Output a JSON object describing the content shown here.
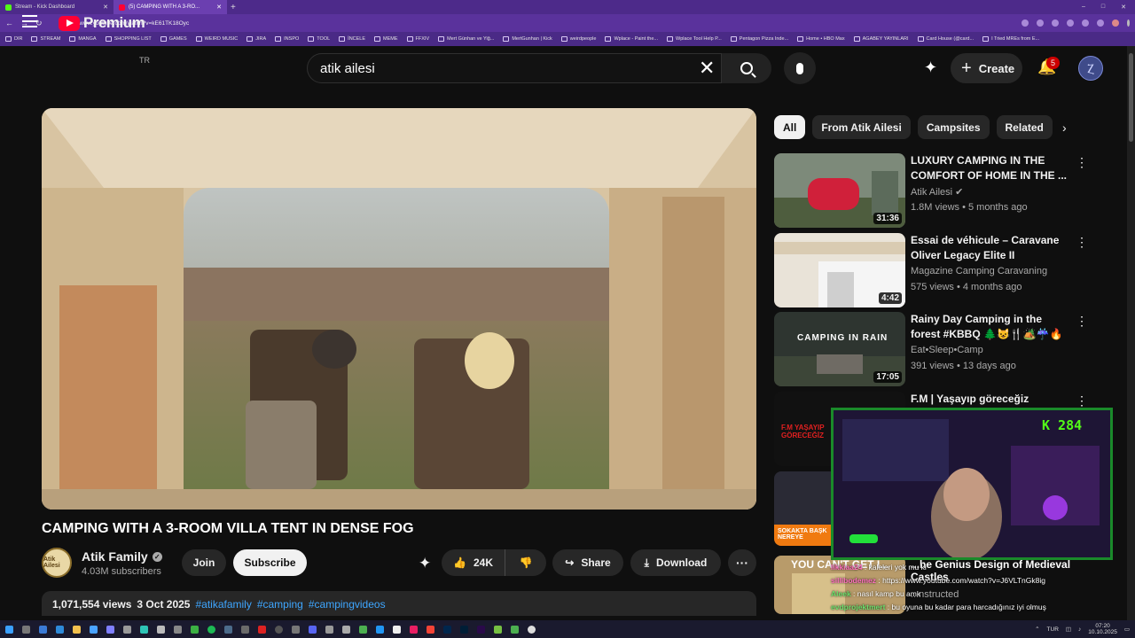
{
  "browser": {
    "tabs": [
      {
        "title": "Stream - Kick Dashboard",
        "favicon_color": "#53fc18",
        "active": false
      },
      {
        "title": "(5) CAMPING WITH A 3-RO...",
        "favicon_color": "#ff0033",
        "active": true
      }
    ],
    "new_tab": "+",
    "window_controls": [
      "–",
      "□",
      "✕"
    ],
    "url": "https://www.youtube.com/watch?v=kE61TK18Oyc",
    "bookmarks": [
      "DIR",
      "STREAM",
      "MANGA",
      "SHOPPING LIST",
      "GAMES",
      "WEIRD MUSIC",
      "JIRA",
      "INSPO",
      "TOOL",
      "İNCELE",
      "MEME",
      "FFXIV",
      "Mert Günhan ve Yiğ...",
      "MertGunhan | Kick",
      "weirdpeople",
      "Wplace - Paint the...",
      "Wplace Tool Help P...",
      "Pentagon Pizza Inde...",
      "Home • HBO Max",
      "AGABEY YAYINLARI",
      "Card House (@card...",
      "I Tried MREs from E..."
    ]
  },
  "header": {
    "logo_text": "Premium",
    "logo_region": "TR",
    "search_value": "atik ailesi",
    "create_label": "Create",
    "notification_count": "5"
  },
  "video": {
    "title": "CAMPING WITH A 3-ROOM VILLA TENT IN DENSE FOG",
    "channel_name": "Atik Family",
    "channel_avatar_text": "Atik Ailesi",
    "subscribers": "4.03M subscribers",
    "join_label": "Join",
    "subscribe_label": "Subscribe",
    "likes": "24K",
    "share_label": "Share",
    "download_label": "Download",
    "more_label": "···",
    "stats": {
      "views": "1,071,554 views",
      "date": "3 Oct 2025",
      "tags": [
        "#atikafamily",
        "#camping",
        "#campingvideos"
      ]
    }
  },
  "sidebar": {
    "chips": [
      "All",
      "From Atik Ailesi",
      "Campsites",
      "Related"
    ],
    "recommendations": [
      {
        "title": "LUXURY CAMPING IN THE COMFORT OF HOME IN THE ...",
        "channel": "Atik Ailesi",
        "verified": true,
        "meta": "1.8M views • 5 months ago",
        "duration": "31:36"
      },
      {
        "title": "Essai de véhicule – Caravane Oliver Legacy Elite II",
        "channel": "Magazine Camping Caravaning",
        "verified": false,
        "meta": "575 views • 4 months ago",
        "duration": "4:42"
      },
      {
        "title": "Rainy Day Camping in the forest #KBBQ 🌲😺🍴🏕️☔🔥",
        "channel": "Eat•Sleep•Camp",
        "verified": false,
        "meta": "391 views • 13 days ago",
        "duration": "17:05",
        "thumb_text": "CAMPING IN RAIN"
      },
      {
        "title": "F.M | Yaşayıp göreceğiz",
        "channel": "",
        "verified": false,
        "meta": "",
        "duration": "",
        "thumb_text": "F.M YAŞAYIP GÖRECEĞİZ"
      },
      {
        "title": "",
        "channel": "",
        "verified": false,
        "meta": "",
        "duration": "",
        "thumb_text": "SOKAKTA BAŞK NEREYE"
      }
    ],
    "partial_title": "YOU CAN'T GET I...",
    "partial_title_right": "...he Genius Design of Medieval Castles",
    "partial_meta": "...nstructed"
  },
  "stream_overlay": {
    "kick_count": "K 284",
    "chat": [
      {
        "user": "likkiaa24",
        "msg": "kaleleri yok mu ki"
      },
      {
        "user": "sillibodemez",
        "msg": "https://www.youtube.com/watch?v=J6VLTnGk8ig"
      },
      {
        "user": "Aleek",
        "msg": "nasıl kamp bu amk"
      },
      {
        "user": "evdprojektmert",
        "msg": "bu oyuna bu kadar para harcadığınız iyi olmuş"
      }
    ]
  },
  "taskbar": {
    "lang": "TUR",
    "time": "07:20",
    "date": "10.10.2025"
  }
}
